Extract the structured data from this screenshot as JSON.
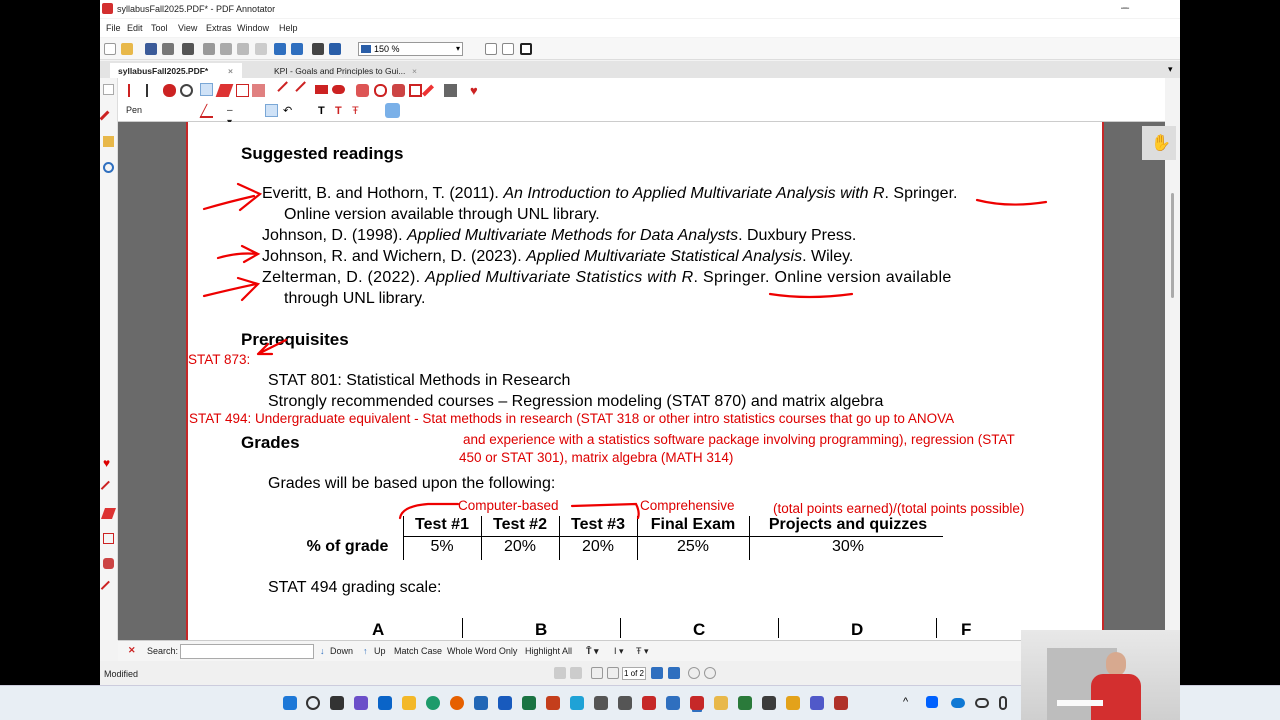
{
  "window": {
    "title": "syllabusFall2025.PDF* - PDF Annotator",
    "minimize": "–",
    "maximize": "❐",
    "close": "✕"
  },
  "menu": [
    "File",
    "Edit",
    "Tool",
    "View",
    "Extras",
    "Window",
    "Help"
  ],
  "toolbar": {
    "zoom": "150 %"
  },
  "tabs": [
    {
      "label": "syllabusFall2025.PDF*",
      "close": "×"
    },
    {
      "label": "KPI - Goals and Principles to Gui...",
      "close": "×"
    }
  ],
  "annotation_toolbar": {
    "pen_label": "Pen"
  },
  "document": {
    "readings_heading": "Suggested readings",
    "refs": [
      {
        "pre": "Everitt, B. and Hothorn, T. (2011). ",
        "title": "An Introduction to Applied Multivariate Analysis with R",
        "post": ". Springer.",
        "line2": "Online version available through UNL library."
      },
      {
        "pre": "Johnson, D. (1998). ",
        "title": "Applied Multivariate Methods for Data Analysts",
        "post": ". Duxbury Press."
      },
      {
        "pre": "Johnson, R. and Wichern, D. (2023). ",
        "title": "Applied Multivariate Statistical Analysis",
        "post": ". Wiley."
      },
      {
        "pre": "Zelterman, D. (2022). ",
        "title": "Applied Multivariate Statistics with R",
        "post": ". Springer. Online version available",
        "line2": "through UNL library."
      }
    ],
    "prereq_heading": "Prerequisites",
    "prereq_lines": [
      "STAT 801: Statistical Methods in Research",
      "Strongly recommended courses – Regression modeling (STAT 870) and matrix algebra"
    ],
    "grades_heading": "Grades",
    "grades_intro": "Grades will be based upon the following:",
    "grades_table": {
      "row_label": "% of grade",
      "columns": [
        "Test #1",
        "Test #2",
        "Test #3",
        "Final Exam",
        "Projects and quizzes"
      ],
      "values": [
        "5%",
        "20%",
        "20%",
        "25%",
        "30%"
      ]
    },
    "scale_label": "STAT 494 grading scale:",
    "scale_letters": [
      "A",
      "B",
      "C",
      "D",
      "F"
    ]
  },
  "ink_notes": {
    "stat873": "STAT 873:",
    "stat494_line1": "STAT 494: Undergraduate equivalent - Stat methods in research (STAT 318 or other intro statistics courses that go up to ANOVA",
    "stat494_line2": "and experience with a statistics software package involving programming), regression (STAT",
    "stat494_line3": "450 or STAT 301), matrix algebra (MATH 314)",
    "computer_based": "Computer-based",
    "comprehensive": "Comprehensive",
    "points_formula": "(total points earned)/(total points possible)"
  },
  "searchbar": {
    "close": "✕",
    "label": "Search:",
    "down": "Down",
    "up": "Up",
    "match_case": "Match Case",
    "whole_word": "Whole Word Only",
    "highlight_all": "Highlight All"
  },
  "statusbar": {
    "status": "Modified",
    "page_indicator": "1 of 2"
  },
  "colors": {
    "accent_red": "#d32f2f",
    "ink_red": "#dd0000",
    "page_border": "#c62828"
  }
}
